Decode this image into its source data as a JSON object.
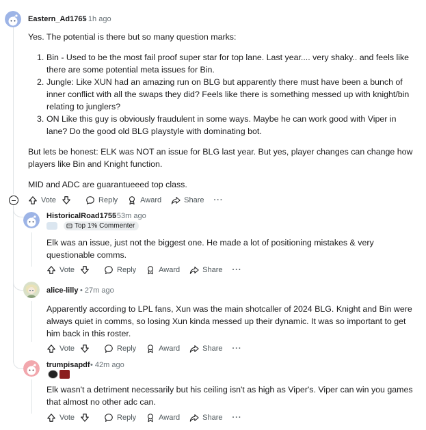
{
  "comments": [
    {
      "username": "Eastern_Ad1765",
      "time": "1h ago",
      "intro": "Yes. The potential is there but so many question marks:",
      "list": [
        {
          "num": "1.",
          "text": "Bin - Used to be the most fail proof super star for top lane. Last year.... very shaky.. and feels like there are some potential meta issues for Bin."
        },
        {
          "num": "2.",
          "text": "Jungle: Like XUN had an amazing run on BLG but apparently there must have been a bunch of inner conflict with all the swaps they did? Feels like there is something messed up with knight/bin relating to junglers?"
        },
        {
          "num": "3.",
          "text": "ON Like this guy is obviously fraudulent in some ways. Maybe he can work good with Viper in lane? Do the good old BLG playstyle with dominating bot."
        }
      ],
      "para2": "But lets be honest: ELK was NOT an issue for BLG last year. But yes, player changes can change how players like Bin and Knight function.",
      "para3": "MID and ADC are guarantueeed top class."
    },
    {
      "username": "HistoricalRoad1755",
      "time": "53m ago",
      "badge": "Top 1% Commenter",
      "text": "Elk was an issue, just not the biggest one. He made a lot of positioning mistakes & very questionable comms."
    },
    {
      "username": "alice-lilly",
      "time": "27m ago",
      "text": "Apparently according to LPL fans, Xun was the main shotcaller of 2024 BLG. Knight and Bin were always quiet in comms, so losing Xun kinda messed up their dynamic. It was so important to get him back in this roster."
    },
    {
      "username": "trumpisapdf",
      "time": "42m ago",
      "text": "Elk wasn't a detriment necessarily but his ceiling isn't as high as Viper's. Viper can win you games that almost no other adc can."
    }
  ],
  "actions": {
    "vote": "Vote",
    "reply": "Reply",
    "award": "Award",
    "share": "Share",
    "more": "···"
  },
  "colors": {
    "thread_line": "#e0e4e7",
    "meta_text": "#6a7378",
    "badge_bg": "#eaedef"
  }
}
